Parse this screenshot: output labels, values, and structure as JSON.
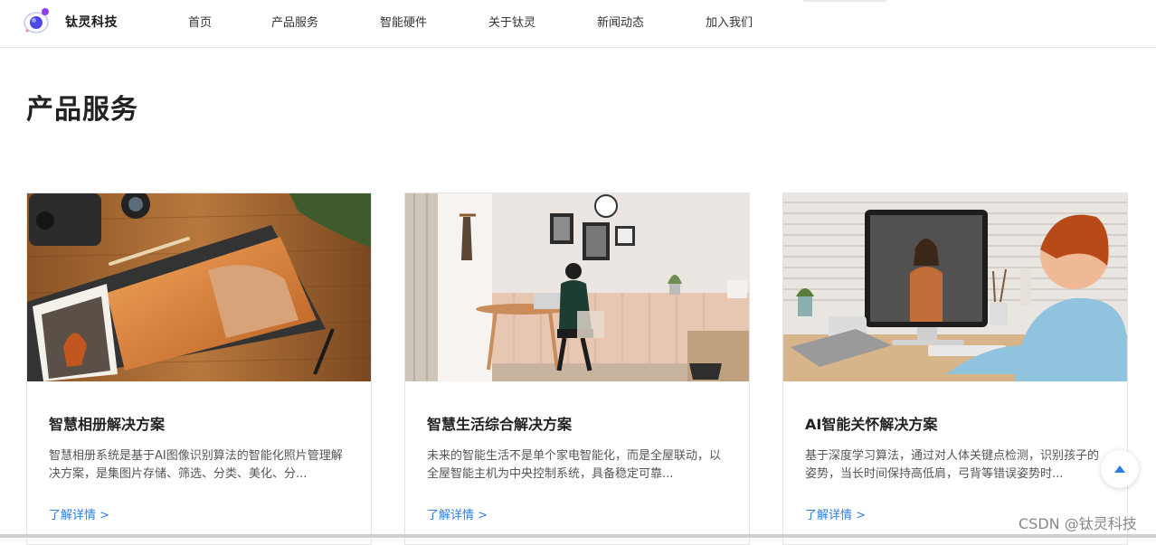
{
  "header": {
    "brand": "钛灵科技",
    "nav": [
      "首页",
      "产品服务",
      "智能硬件",
      "关于钛灵",
      "新闻动态",
      "加入我们"
    ]
  },
  "section": {
    "title": "产品服务"
  },
  "cards": [
    {
      "title": "智慧相册解决方案",
      "desc": "智慧相册系统是基于AI图像识别算法的智能化照片管理解决方案，是集图片存储、筛选、分类、美化、分...",
      "link": "了解详情 >"
    },
    {
      "title": "智慧生活综合解决方案",
      "desc": "未来的智能生活不是单个家电智能化，而是全屋联动，以全屋智能主机为中央控制系统，具备稳定可靠...",
      "link": "了解详情 >"
    },
    {
      "title": "AI智能关怀解决方案",
      "desc": "基于深度学习算法，通过对人体关键点检测，识别孩子的姿势，当长时间保持高低肩，弓背等错误姿势时...",
      "link": "了解详情 >"
    }
  ],
  "watermark": "CSDN @钛灵科技",
  "colors": {
    "link": "#2f7de1",
    "accent": "#2f7de1",
    "logo_purple": "#7b3fe4"
  },
  "icons": {
    "back_to_top": "arrow-up-icon",
    "logo": "orbit-logo-icon"
  }
}
